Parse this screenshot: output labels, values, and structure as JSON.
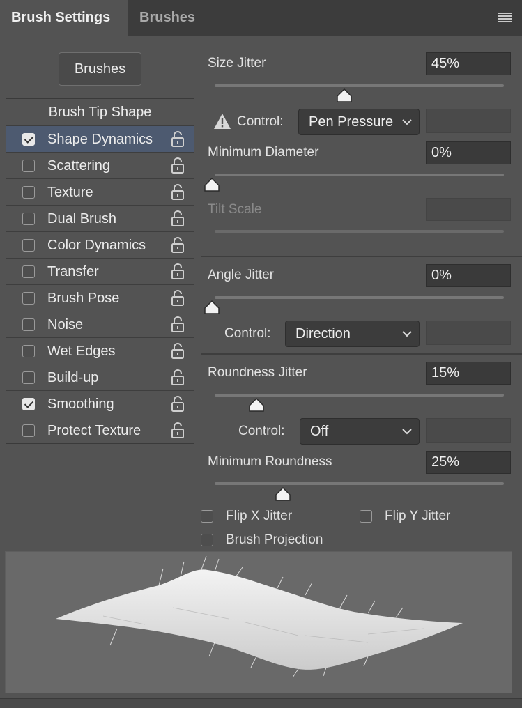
{
  "tabs": {
    "active": "Brush Settings",
    "inactive": "Brushes"
  },
  "brushes_button": "Brushes",
  "tip_list": {
    "header": "Brush Tip Shape",
    "items": [
      {
        "label": "Shape Dynamics",
        "checked": true,
        "selected": true
      },
      {
        "label": "Scattering",
        "checked": false
      },
      {
        "label": "Texture",
        "checked": false
      },
      {
        "label": "Dual Brush",
        "checked": false
      },
      {
        "label": "Color Dynamics",
        "checked": false
      },
      {
        "label": "Transfer",
        "checked": false
      },
      {
        "label": "Brush Pose",
        "checked": false
      },
      {
        "label": "Noise",
        "checked": false
      },
      {
        "label": "Wet Edges",
        "checked": false
      },
      {
        "label": "Build-up",
        "checked": false
      },
      {
        "label": "Smoothing",
        "checked": true
      },
      {
        "label": "Protect Texture",
        "checked": false
      }
    ]
  },
  "settings": {
    "size_jitter": {
      "label": "Size Jitter",
      "value": "45%",
      "slider_fraction": 0.45
    },
    "control1": {
      "label": "Control:",
      "selected": "Pen Pressure"
    },
    "min_diameter": {
      "label": "Minimum Diameter",
      "value": "0%",
      "slider_fraction": 0.0
    },
    "tilt_scale": {
      "label": "Tilt Scale",
      "value": ""
    },
    "angle_jitter": {
      "label": "Angle Jitter",
      "value": "0%",
      "slider_fraction": 0.0
    },
    "control2": {
      "label": "Control:",
      "selected": "Direction"
    },
    "roundness_jitter": {
      "label": "Roundness Jitter",
      "value": "15%",
      "slider_fraction": 0.15
    },
    "control3": {
      "label": "Control:",
      "selected": "Off"
    },
    "min_roundness": {
      "label": "Minimum Roundness",
      "value": "25%",
      "slider_fraction": 0.25
    },
    "flip_x": {
      "label": "Flip X Jitter",
      "checked": false
    },
    "flip_y": {
      "label": "Flip Y Jitter",
      "checked": false
    },
    "brush_projection": {
      "label": "Brush Projection",
      "checked": false
    }
  },
  "colors": {
    "panel_bg": "#535353",
    "selected_row": "#4d5a70",
    "field_bg": "#3a3a3a"
  }
}
